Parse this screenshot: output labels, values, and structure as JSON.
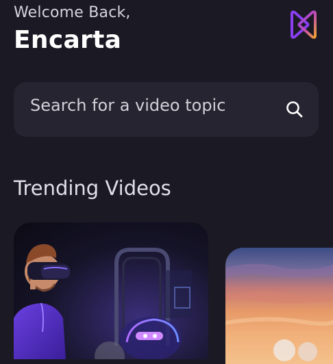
{
  "header": {
    "greeting": "Welcome Back,",
    "username": "Encarta",
    "logo_icon": "app-logo-icon",
    "logo_colors": [
      "#8a3ff0",
      "#f0a030"
    ]
  },
  "search": {
    "placeholder": "Search for a video topic",
    "icon": "search-icon"
  },
  "trending": {
    "title": "Trending Videos",
    "cards": [
      {
        "thumbnail": "vr-headset-person-thumbnail"
      },
      {
        "thumbnail": "sunset-sky-thumbnail"
      }
    ]
  },
  "theme": {
    "background": "#1a1924",
    "surface": "#252430",
    "text": "#ffffff"
  }
}
